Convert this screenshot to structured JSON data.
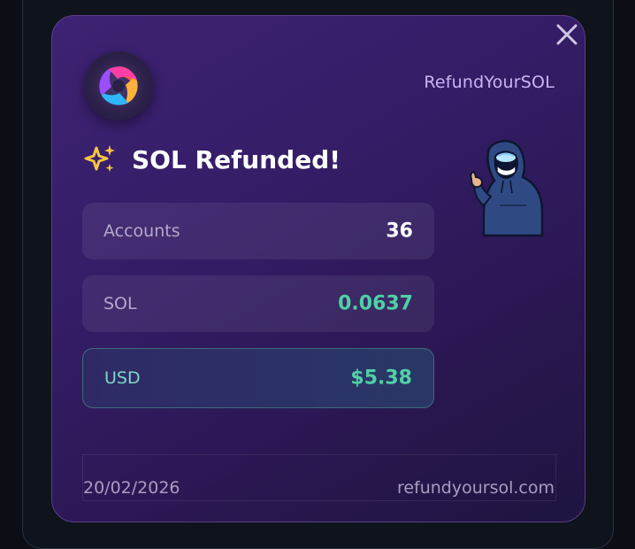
{
  "brand": {
    "name": "RefundYourSOL"
  },
  "title": "SOL Refunded!",
  "stats": {
    "accounts": {
      "label": "Accounts",
      "value": "36"
    },
    "sol": {
      "label": "SOL",
      "value": "0.0637"
    },
    "usd": {
      "label": "USD",
      "value": "$5.38"
    }
  },
  "footer": {
    "date": "20/02/2026",
    "site": "refundyoursol.com"
  },
  "colors": {
    "card_bg": "#341d66",
    "value_white": "#ffffff",
    "value_green": "#4fd1a5",
    "sparkle": "#f5c542"
  },
  "icons": {
    "close": "close-icon",
    "logo": "swirl-logo-icon",
    "sparkle": "sparkle-icon",
    "mascot": "hooded-mascot-thumbs-up"
  }
}
